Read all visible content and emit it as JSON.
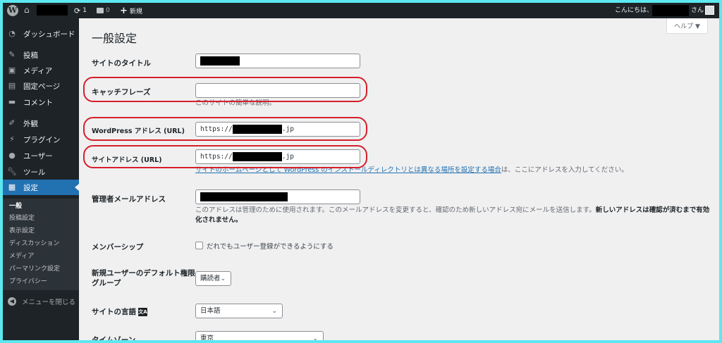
{
  "adminbar": {
    "updates_count": "1",
    "comments_count": "0",
    "new_label": "新規",
    "greeting": "こんにちは、",
    "honorific": "さん"
  },
  "sidebar": {
    "items": [
      {
        "label": "ダッシュボード",
        "icon": "dashboard-icon"
      },
      {
        "label": "投稿",
        "icon": "pin-icon"
      },
      {
        "label": "メディア",
        "icon": "media-icon"
      },
      {
        "label": "固定ページ",
        "icon": "page-icon"
      },
      {
        "label": "コメント",
        "icon": "comment-icon"
      },
      {
        "label": "外観",
        "icon": "brush-icon"
      },
      {
        "label": "プラグイン",
        "icon": "plugin-icon"
      },
      {
        "label": "ユーザー",
        "icon": "user-icon"
      },
      {
        "label": "ツール",
        "icon": "wrench-icon"
      },
      {
        "label": "設定",
        "icon": "settings-icon"
      }
    ],
    "submenu": [
      "一般",
      "投稿設定",
      "表示設定",
      "ディスカッション",
      "メディア",
      "パーマリンク設定",
      "プライバシー"
    ],
    "collapse_label": "メニューを閉じる"
  },
  "main": {
    "help_label": "ヘルプ ▼",
    "page_title": "一般設定",
    "site_title_label": "サイトのタイトル",
    "tagline_label": "キャッチフレーズ",
    "tagline_value": "",
    "tagline_desc": "このサイトの簡単な説明。",
    "wp_address_label": "WordPress アドレス (URL)",
    "wp_address_prefix": "https://",
    "wp_address_suffix": ".jp",
    "site_address_label": "サイトアドレス (URL)",
    "site_address_prefix": "https://",
    "site_address_suffix": ".jp",
    "site_address_desc_link": "サイトのホームページとして WordPress のインストールディレクトリとは異なる場所を設定する場合",
    "site_address_desc_rest": "は、ここにアドレスを入力してください。",
    "admin_email_label": "管理者メールアドレス",
    "admin_email_desc": "このアドレスは管理のために使用されます。このメールアドレスを変更すると、確認のため新しいアドレス宛にメールを送信します。",
    "admin_email_desc_bold_1": "新しいアドレスは確認が済むまで有効",
    "admin_email_desc_bold_2": "化されません。",
    "membership_label": "メンバーシップ",
    "membership_checkbox_label": "だれでもユーザー登録ができるようにする",
    "default_role_label_1": "新規ユーザーのデフォルト権限",
    "default_role_label_2": "グループ",
    "default_role_value": "購読者",
    "site_language_label": "サイトの言語",
    "site_language_value": "日本語",
    "timezone_label": "タイムゾーン",
    "timezone_value": "東京"
  },
  "colors": {
    "adminbar_bg": "#1d2327",
    "active_menu": "#2271b1",
    "highlight_ring": "#d6202b",
    "frame_border": "#5ce8f0"
  }
}
